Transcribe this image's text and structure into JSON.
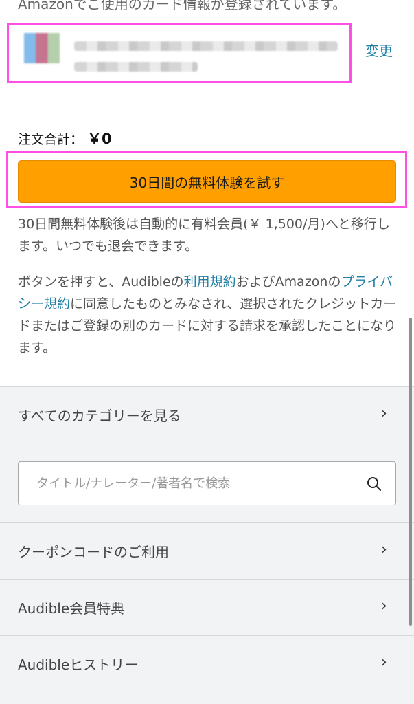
{
  "card_notice": "Amazonでご使用のカード情報が登録されています。",
  "payment": {
    "change_label": "変更"
  },
  "order": {
    "total_label": "注文合計：",
    "total_value": "￥0"
  },
  "cta": {
    "label": "30日間の無料体験を試す"
  },
  "info": {
    "trial_notice": "30日間無料体験後は自動的に有料会員(￥ 1,500/月)へと移行します。いつでも退会できます。",
    "terms_prefix": "ボタンを押すと、Audibleの",
    "terms_link": "利用規約",
    "terms_mid": "およびAmazonの",
    "privacy_link": "プライバシー規約",
    "terms_suffix": "に同意したものとみなされ、選択されたクレジットカードまたはご登録の別のカードに対する請求を承認したことになります。"
  },
  "menu": {
    "categories": "すべてのカテゴリーを見る",
    "coupon": "クーポンコードのご利用",
    "benefits": "Audible会員特典",
    "history": "Audibleヒストリー"
  },
  "search": {
    "placeholder": "タイトル/ナレーター/著者名で検索"
  },
  "icons": {
    "chevron": "chevron-right-icon",
    "search": "search-icon"
  },
  "colors": {
    "cta": "#ff9f00",
    "link": "#1f7fa5",
    "highlight": "#ff4fe6"
  }
}
